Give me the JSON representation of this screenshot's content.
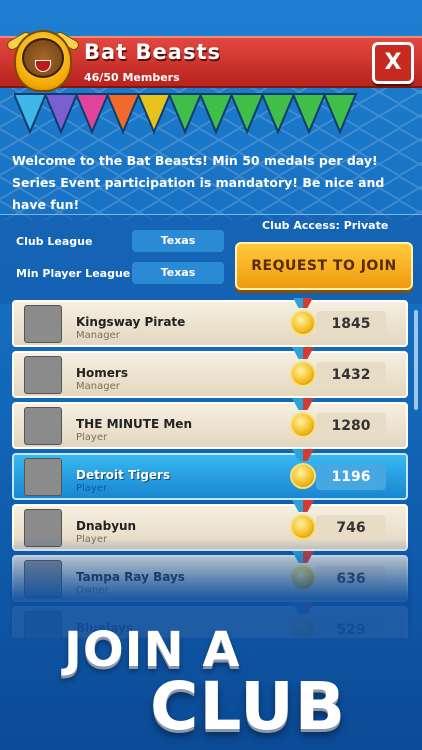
{
  "club": {
    "name": "Bat Beasts",
    "members": "46/50 Members",
    "close_label": "X",
    "welcome": "Welcome to the Bat Beasts! Min 50 medals per day! Series Event participation is mandatory! Be nice and have fun!",
    "access": "Club Access: Private"
  },
  "info": {
    "club_league_label": "Club League",
    "club_league_value": "Texas",
    "min_league_label": "Min Player League",
    "min_league_value": "Texas"
  },
  "join_button": "REQUEST TO JOIN",
  "medal_colors": [
    "#3fb7e8",
    "#7b5ed0",
    "#e0449a",
    "#f06a2a",
    "#e5c21c",
    "#3fbf4a",
    "#3fbf4a",
    "#3fbf4a",
    "#3fbf4a",
    "#3fbf4a",
    "#3fbf4a"
  ],
  "members_list": [
    {
      "name": "Kingsway Pirate",
      "role": "Manager",
      "score": "1845",
      "highlight": false
    },
    {
      "name": "Homers",
      "role": "Manager",
      "score": "1432",
      "highlight": false
    },
    {
      "name": "THE MINUTE Men",
      "role": "Player",
      "score": "1280",
      "highlight": false
    },
    {
      "name": "Detroit Tigers",
      "role": "Player",
      "score": "1196",
      "highlight": true
    },
    {
      "name": "Dnabyun",
      "role": "Player",
      "score": "746",
      "highlight": false
    },
    {
      "name": "Tampa Ray Bays",
      "role": "Owner",
      "score": "636",
      "highlight": false
    },
    {
      "name": "BlueJays",
      "role": "",
      "score": "529",
      "highlight": false
    }
  ],
  "promo": {
    "line1": "JOIN A",
    "line2": "CLUB"
  }
}
